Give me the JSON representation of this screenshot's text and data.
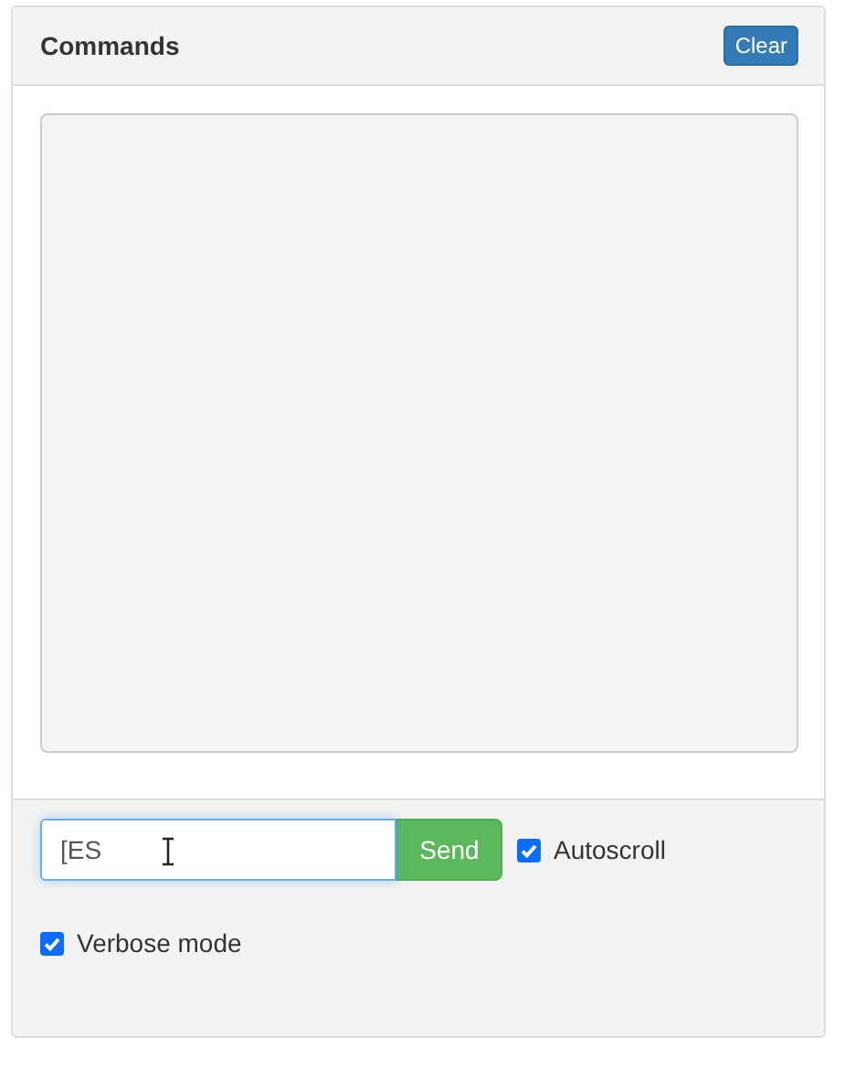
{
  "panel": {
    "title": "Commands",
    "clear_button": "Clear"
  },
  "command": {
    "value": "[ES",
    "send_button": "Send"
  },
  "options": [
    {
      "label": "Autoscroll",
      "checked": true
    },
    {
      "label": "Verbose mode",
      "checked": true
    }
  ]
}
